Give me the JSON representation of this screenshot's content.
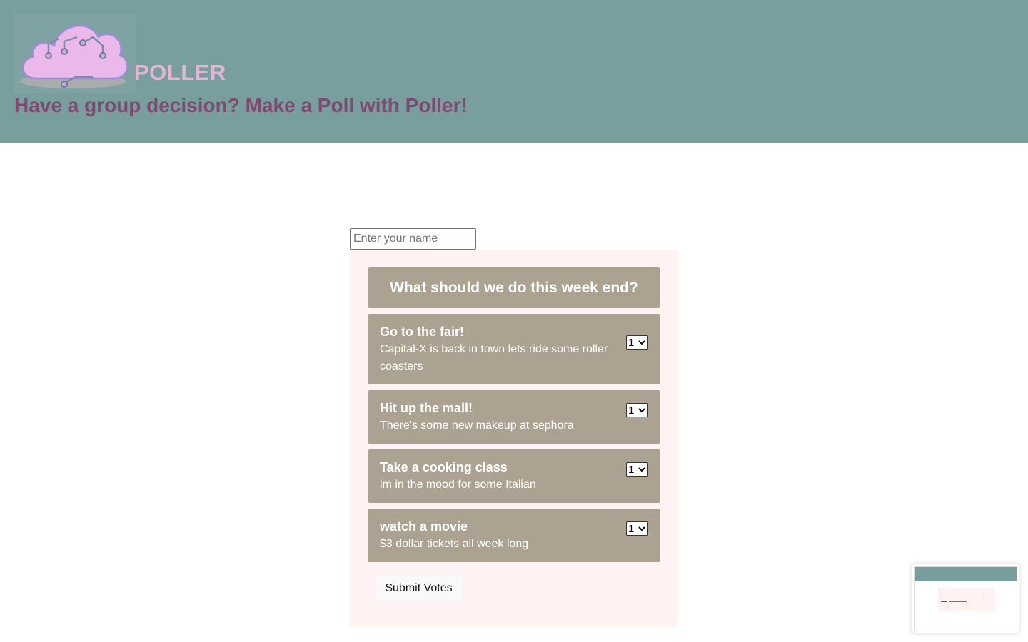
{
  "header": {
    "brand": "POLLER",
    "tagline": "Have a group decision? Make a Poll with Poller!",
    "logo_icon": "cloud-circuit-logo-icon"
  },
  "name_input": {
    "placeholder": "Enter your name",
    "value": ""
  },
  "poll": {
    "title": "What should we do this week end?",
    "options": [
      {
        "title": "Go to the fair!",
        "description": "Capital-X is back in town lets ride some roller coasters",
        "rank": "1"
      },
      {
        "title": "Hit up the mall!",
        "description": "There's some new makeup at sephora",
        "rank": "1"
      },
      {
        "title": "Take a cooking class",
        "description": "im in the mood for some Italian",
        "rank": "1"
      },
      {
        "title": "watch a movie",
        "description": "$3 dollar tickets all week long",
        "rank": "1"
      }
    ],
    "submit_label": "Submit Votes"
  },
  "colors": {
    "header_bg": "#789f9e",
    "brand": "#e6b3d3",
    "tagline": "#7e4a71",
    "card_bg": "#fff2f2",
    "option_bg": "#aca291"
  },
  "screenshot_preview_icon": "screenshot-thumbnail-icon"
}
